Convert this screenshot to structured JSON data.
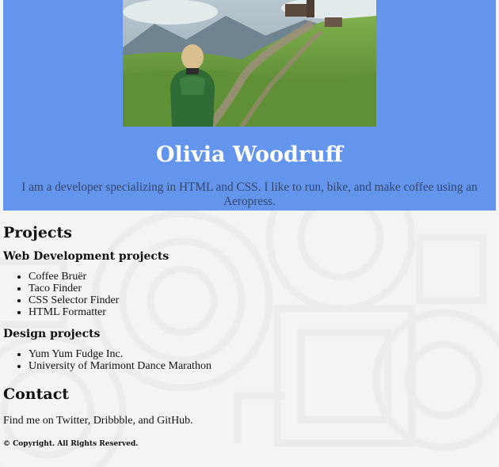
{
  "header": {
    "photo_alt": "Photo of Olivia Woodruff hiking on a green hillside",
    "name": "Olivia Woodruff",
    "bio": "I am a developer specializing in HTML and CSS. I like to run, bike, and make coffee using an Aeropress."
  },
  "projects": {
    "title": "Projects",
    "web": {
      "title": "Web Development projects",
      "items": [
        "Coffee Bruër",
        "Taco Finder",
        "CSS Selector Finder",
        "HTML Formatter"
      ]
    },
    "design": {
      "title": "Design projects",
      "items": [
        "Yum Yum Fudge Inc.",
        "University of Marimont Dance Marathon"
      ]
    }
  },
  "contact": {
    "title": "Contact",
    "text": "Find me on Twitter, Dribbble, and GitHub."
  },
  "footer": {
    "copyright": "© Copyright. All Rights Reserved."
  },
  "colors": {
    "header_bg": "#6495ed",
    "name_color": "#ffffff",
    "bio_color": "#34466b",
    "page_bg": "#f4f4f4"
  }
}
